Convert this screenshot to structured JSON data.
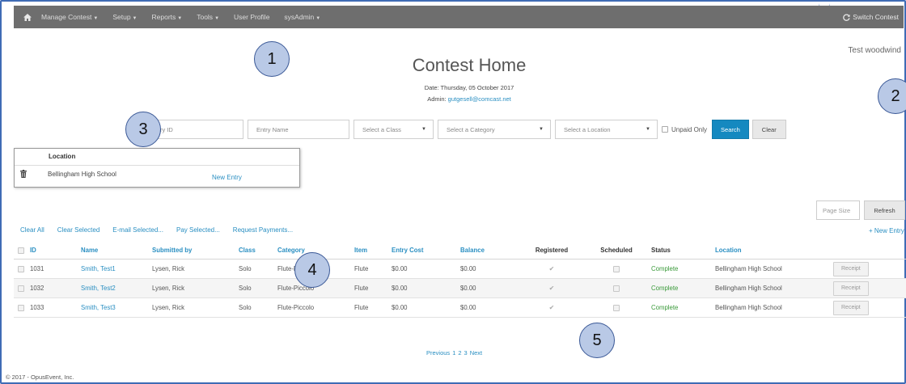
{
  "nav": {
    "items": [
      {
        "label": "Manage Contest",
        "dropdown": true
      },
      {
        "label": "Setup",
        "dropdown": true
      },
      {
        "label": "Reports",
        "dropdown": true
      },
      {
        "label": "Tools",
        "dropdown": true
      },
      {
        "label": "User Profile",
        "dropdown": false
      },
      {
        "label": "sysAdmin",
        "dropdown": true
      }
    ],
    "switch_contest": "Switch Contest",
    "home_icon": "home-icon",
    "switch_icon": "refresh-icon"
  },
  "header": {
    "title": "Contest Home",
    "date": "Date: Thursday, 05 October 2017",
    "admin_label": "Admin: ",
    "admin_email": "gutgesell@comcast.net",
    "user_name": "Test woodwind"
  },
  "callouts": [
    "1",
    "2",
    "3",
    "4",
    "5"
  ],
  "search": {
    "entry_id_placeholder": "ry ID",
    "entry_name_placeholder": "Entry Name",
    "class_select": "Select a Class",
    "category_select": "Select a Category",
    "location_select": "Select a Location",
    "unpaid_only": "Unpaid Only",
    "search_button": "Search",
    "clear_button": "Clear"
  },
  "location_popup": {
    "header": "Location",
    "location_name": "Bellingham High School",
    "new_entry": "New Entry"
  },
  "controls": {
    "page_size_placeholder": "Page Size",
    "refresh": "Refresh"
  },
  "actions": {
    "clear_all": "Clear All",
    "clear_selected": "Clear Selected",
    "email_selected": "E-mail Selected...",
    "pay_selected": "Pay Selected...",
    "request_payments": "Request Payments...",
    "new_entry": "+ New Entry"
  },
  "table": {
    "columns": [
      "ID",
      "Name",
      "Submitted by",
      "Class",
      "Category",
      "Item",
      "Entry Cost",
      "Balance",
      "Registered",
      "Scheduled",
      "Status",
      "Location"
    ],
    "rows": [
      {
        "id": "1031",
        "name": "Smith, Test1",
        "submitted_by": "Lysen, Rick",
        "class": "Solo",
        "category": "Flute-Piccolo",
        "item": "Flute",
        "entry_cost": "$0.00",
        "balance": "$0.00",
        "registered": true,
        "scheduled": false,
        "status": "Complete",
        "location": "Bellingham High School",
        "receipt": "Receipt"
      },
      {
        "id": "1032",
        "name": "Smith, Test2",
        "submitted_by": "Lysen, Rick",
        "class": "Solo",
        "category": "Flute-Piccolo",
        "item": "Flute",
        "entry_cost": "$0.00",
        "balance": "$0.00",
        "registered": true,
        "scheduled": false,
        "status": "Complete",
        "location": "Bellingham High School",
        "receipt": "Receipt"
      },
      {
        "id": "1033",
        "name": "Smith, Test3",
        "submitted_by": "Lysen, Rick",
        "class": "Solo",
        "category": "Flute-Piccolo",
        "item": "Flute",
        "entry_cost": "$0.00",
        "balance": "$0.00",
        "registered": true,
        "scheduled": false,
        "status": "Complete",
        "location": "Bellingham High School",
        "receipt": "Receipt"
      }
    ]
  },
  "pagination": {
    "previous": "Previous",
    "pages": [
      "1",
      "2",
      "3"
    ],
    "next": "Next"
  },
  "footer": "© 2017 - OpusEvent, Inc.",
  "colors": {
    "nav_bg": "#6e6e6e",
    "accent": "#1589c0",
    "link": "#2a8fc2",
    "status_complete": "#3a9a3a",
    "callout_fill": "#b9c9e6",
    "frame": "#3f6bb5"
  }
}
